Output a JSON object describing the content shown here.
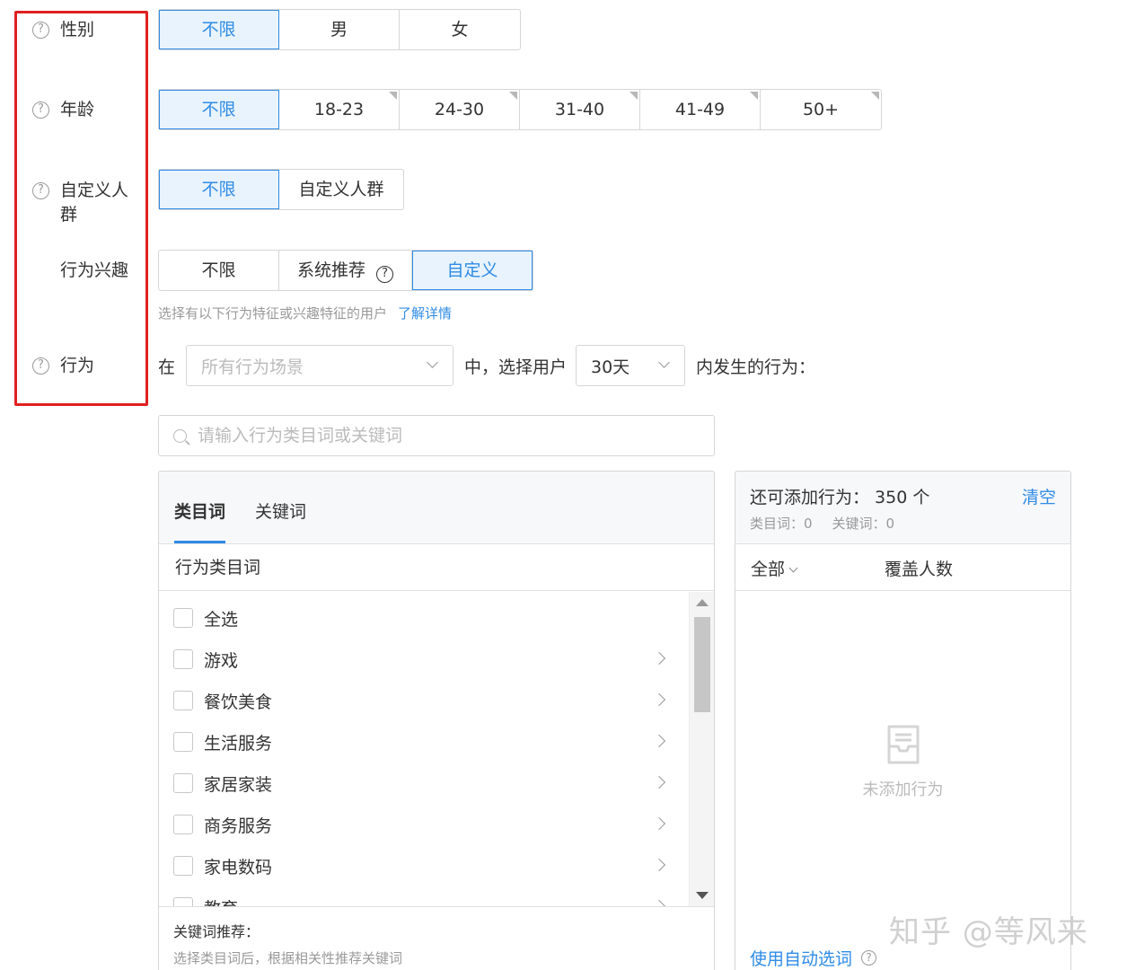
{
  "labels": {
    "gender": "性别",
    "age": "年龄",
    "custom_crowd": "自定义人群",
    "interest": "行为兴趣",
    "behavior": "行为"
  },
  "gender": {
    "options": [
      "不限",
      "男",
      "女"
    ],
    "selected": "不限"
  },
  "age": {
    "options": [
      "不限",
      "18-23",
      "24-30",
      "31-40",
      "41-49",
      "50+"
    ],
    "selected": "不限"
  },
  "custom_crowd": {
    "options": [
      "不限",
      "自定义人群"
    ],
    "selected": "不限"
  },
  "interest": {
    "options": [
      "不限",
      "系统推荐",
      "自定义"
    ],
    "selected": "自定义",
    "help_glyph": "?"
  },
  "interest_hint": {
    "text": "选择有以下行为特征或兴趣特征的用户",
    "link": "了解详情"
  },
  "behavior_line": {
    "prefix": "在",
    "scene_placeholder": "所有行为场景",
    "middle": "中，选择用户",
    "days": "30天",
    "suffix": "内发生的行为："
  },
  "search": {
    "placeholder": "请输入行为类目词或关键词"
  },
  "left_panel": {
    "tabs": [
      "类目词",
      "关键词"
    ],
    "active_tab": "类目词",
    "column_header": "行为类目词",
    "items": [
      "全选",
      "游戏",
      "餐饮美食",
      "生活服务",
      "家居家装",
      "商务服务",
      "家电数码",
      "教育"
    ],
    "keyword_rec_title": "关键词推荐：",
    "keyword_rec_desc": "选择类目词后，根据相关性推荐关键词"
  },
  "right_panel": {
    "count_label": "还可添加行为：",
    "count_value": "350 个",
    "clear": "清空",
    "category_count": "类目词：0",
    "keyword_count": "关键词：0",
    "filter_all": "全部",
    "col_coverage": "覆盖人数",
    "empty_text": "未添加行为",
    "auto_pick": "使用自动选词"
  },
  "watermark": "知乎 @等风来",
  "colors": {
    "accent": "#2f8be6",
    "highlight_box": "#e02020",
    "selected_bg": "#e8f3fd"
  },
  "icons": {
    "help": "question-circle-icon",
    "search": "search-icon",
    "empty": "inbox-icon"
  }
}
